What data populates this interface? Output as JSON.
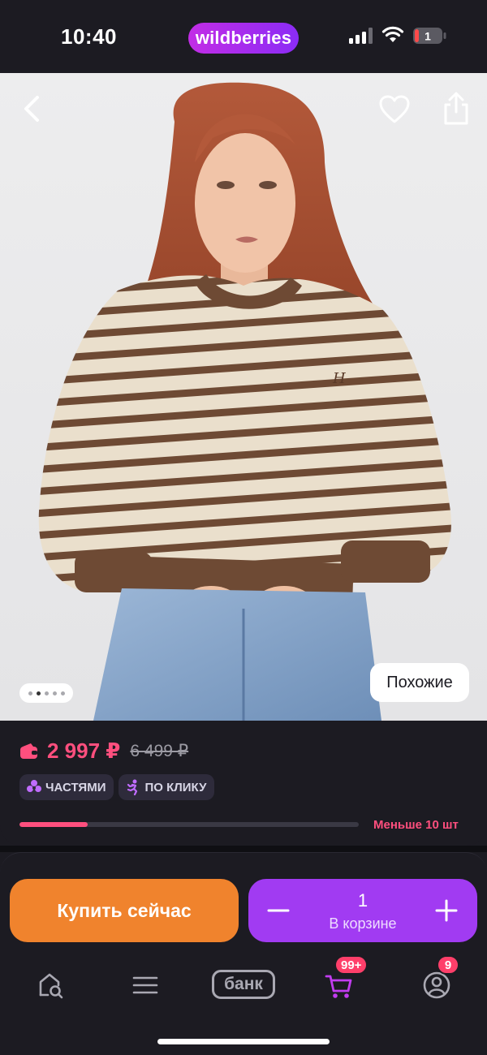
{
  "status_bar": {
    "time": "10:40",
    "brand": "wildberries",
    "battery_level": "1"
  },
  "product": {
    "image_pager": {
      "count": 5,
      "active_index": 1
    },
    "similar_label": "Похожие",
    "price": "2 997 ₽",
    "old_price": "6 499 ₽",
    "chips": [
      {
        "label": "ЧАСТЯМИ",
        "icon": "installments-icon"
      },
      {
        "label": "ПО КЛИКУ",
        "icon": "runner-icon"
      }
    ],
    "stock": {
      "label": "Меньше 10 шт",
      "level": 0.2
    }
  },
  "actions": {
    "buy_now_label": "Купить сейчас",
    "cart_quantity": "1",
    "cart_label": "В корзине"
  },
  "nav": {
    "items": [
      {
        "name": "home-search",
        "icon": "home-search-icon"
      },
      {
        "name": "catalog",
        "icon": "menu-icon"
      },
      {
        "name": "bank",
        "label": "банк"
      },
      {
        "name": "cart",
        "icon": "cart-icon",
        "badge": "99+"
      },
      {
        "name": "profile",
        "icon": "profile-icon",
        "badge": "9"
      }
    ]
  },
  "colors": {
    "background": "#1c1b22",
    "price": "#ff4f7e",
    "buy_button": "#f0832d",
    "cart_button": "#a13bf2",
    "brand_gradient_start": "#c22de6",
    "brand_gradient_end": "#8b2cf5"
  }
}
